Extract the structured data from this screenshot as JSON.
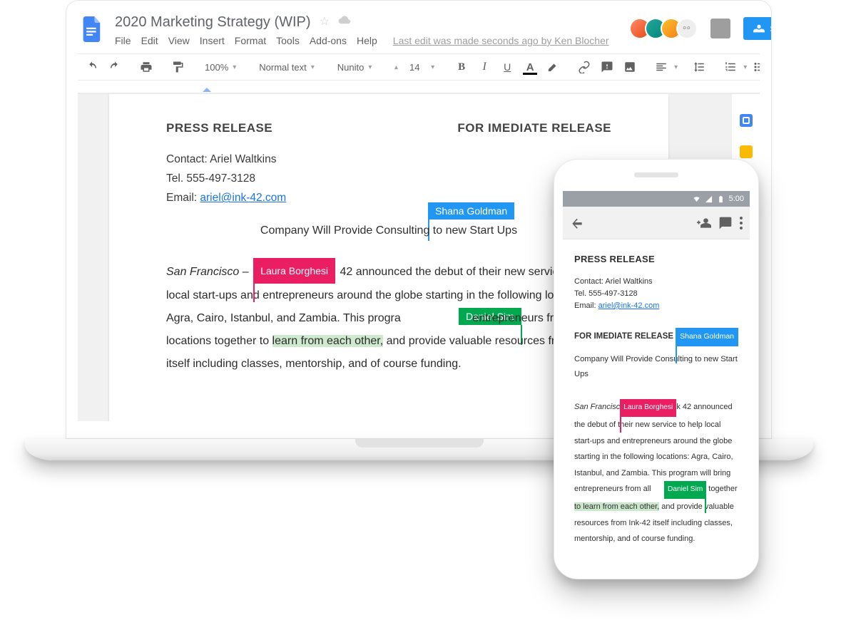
{
  "header": {
    "title": "2020 Marketing Strategy (WIP)",
    "menus": [
      "File",
      "Edit",
      "View",
      "Insert",
      "Format",
      "Tools",
      "Add-ons",
      "Help"
    ],
    "edit_note": "Last edit was made seconds ago by Ken Blocher",
    "share_label": "SHARE"
  },
  "toolbar": {
    "zoom": "100%",
    "style": "Normal text",
    "font": "Nunito",
    "size": "14"
  },
  "collaborators": {
    "shana": "Shana Goldman",
    "laura": "Laura Borghesi",
    "daniel": "Daniel Sim"
  },
  "colors": {
    "shana": "#2196f3",
    "laura": "#e91e63",
    "daniel": "#00a94f",
    "highlight": "rgba(76,175,80,0.28)"
  },
  "doc": {
    "heading_left": "PRESS RELEASE",
    "heading_right": "FOR IMEDIATE RELEASE",
    "contact_line": "Contact: Ariel Waltkins",
    "tel_line": "Tel. 555-497-3128",
    "email_prefix": "Email: ",
    "email": "ariel@ink-42.com",
    "subtitle_a": "Company Will Provide Consulting",
    "subtitle_b": " to new Start Ups",
    "para_a": "San Francisco",
    "para_b": " – ",
    "para_c": " 42 announced the debut of their new service to help local start-ups and entrepreneurs around the globe starting in the following locations: Agra, Cairo, Istanbul, and Zambia. This progra",
    "para_d": " entrepreneurs from all the locations together to ",
    "highlight": "learn from each other,",
    "para_e": " and provide valuable resources from Ink-42 itself including classes, mentorship, and of course funding."
  },
  "phone": {
    "time": "5:00",
    "heading": "PRESS RELEASE",
    "release": "FOR IMEDIATE RELEASE",
    "sub_a": "Company Will Provide Consulting",
    "sub_b": " to new Start Ups",
    "p_a": "San Francisc",
    "p_b": "k 42 announced the debut of their new service to help local start-ups and entrepreneurs around the globe starting in the following locations: Agra, Cairo, Istanbul, and Zambia. This program will bring entrepreneurs from all ",
    "p_c": "together ",
    "p_hl": "to learn from each other,",
    "p_d": " and provide valuable resources from Ink-42 itself including classes, mentorship, and of course funding."
  }
}
